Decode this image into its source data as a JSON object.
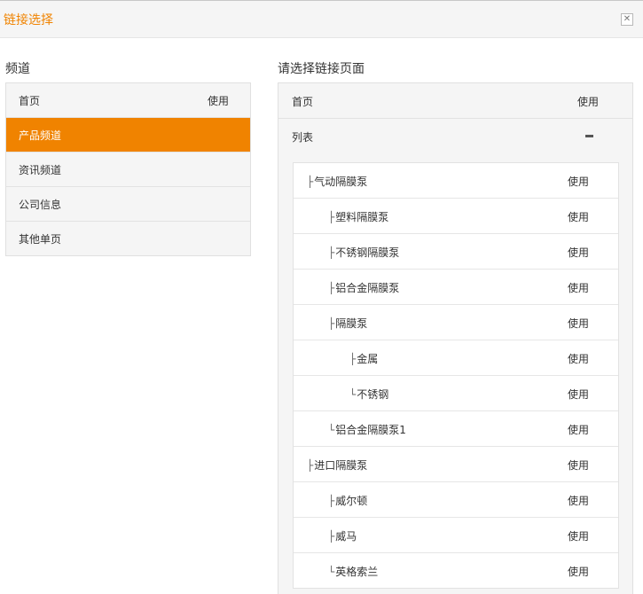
{
  "dialog": {
    "title": "链接选择",
    "close_icon": "close-icon"
  },
  "left": {
    "title": "频道",
    "items": [
      {
        "label": "首页",
        "use_label": "使用"
      },
      {
        "label": "产品频道",
        "use_label": ""
      },
      {
        "label": "资讯频道",
        "use_label": ""
      },
      {
        "label": "公司信息",
        "use_label": ""
      },
      {
        "label": "其他单页",
        "use_label": ""
      }
    ]
  },
  "right": {
    "title": "请选择链接页面",
    "home": {
      "label": "首页",
      "use_label": "使用"
    },
    "list": {
      "label": "列表"
    },
    "tree": [
      {
        "glyph": "├",
        "label": "气动隔膜泵",
        "use_label": "使用"
      },
      {
        "glyph": "├",
        "label": "塑料隔膜泵",
        "use_label": "使用"
      },
      {
        "glyph": "├",
        "label": "不锈钢隔膜泵",
        "use_label": "使用"
      },
      {
        "glyph": "├",
        "label": "铝合金隔膜泵",
        "use_label": "使用"
      },
      {
        "glyph": "├",
        "label": "隔膜泵",
        "use_label": "使用"
      },
      {
        "glyph": "├",
        "label": "金属",
        "use_label": "使用"
      },
      {
        "glyph": "└",
        "label": "不锈钢",
        "use_label": "使用"
      },
      {
        "glyph": "└",
        "label": "铝合金隔膜泵1",
        "use_label": "使用"
      },
      {
        "glyph": "├",
        "label": "进口隔膜泵",
        "use_label": "使用"
      },
      {
        "glyph": "├",
        "label": "威尔顿",
        "use_label": "使用"
      },
      {
        "glyph": "├",
        "label": "威马",
        "use_label": "使用"
      },
      {
        "glyph": "└",
        "label": "英格索兰",
        "use_label": "使用"
      }
    ]
  },
  "colors": {
    "accent": "#f08300",
    "panel_bg": "#f5f5f5",
    "border": "#e2e2e2"
  }
}
